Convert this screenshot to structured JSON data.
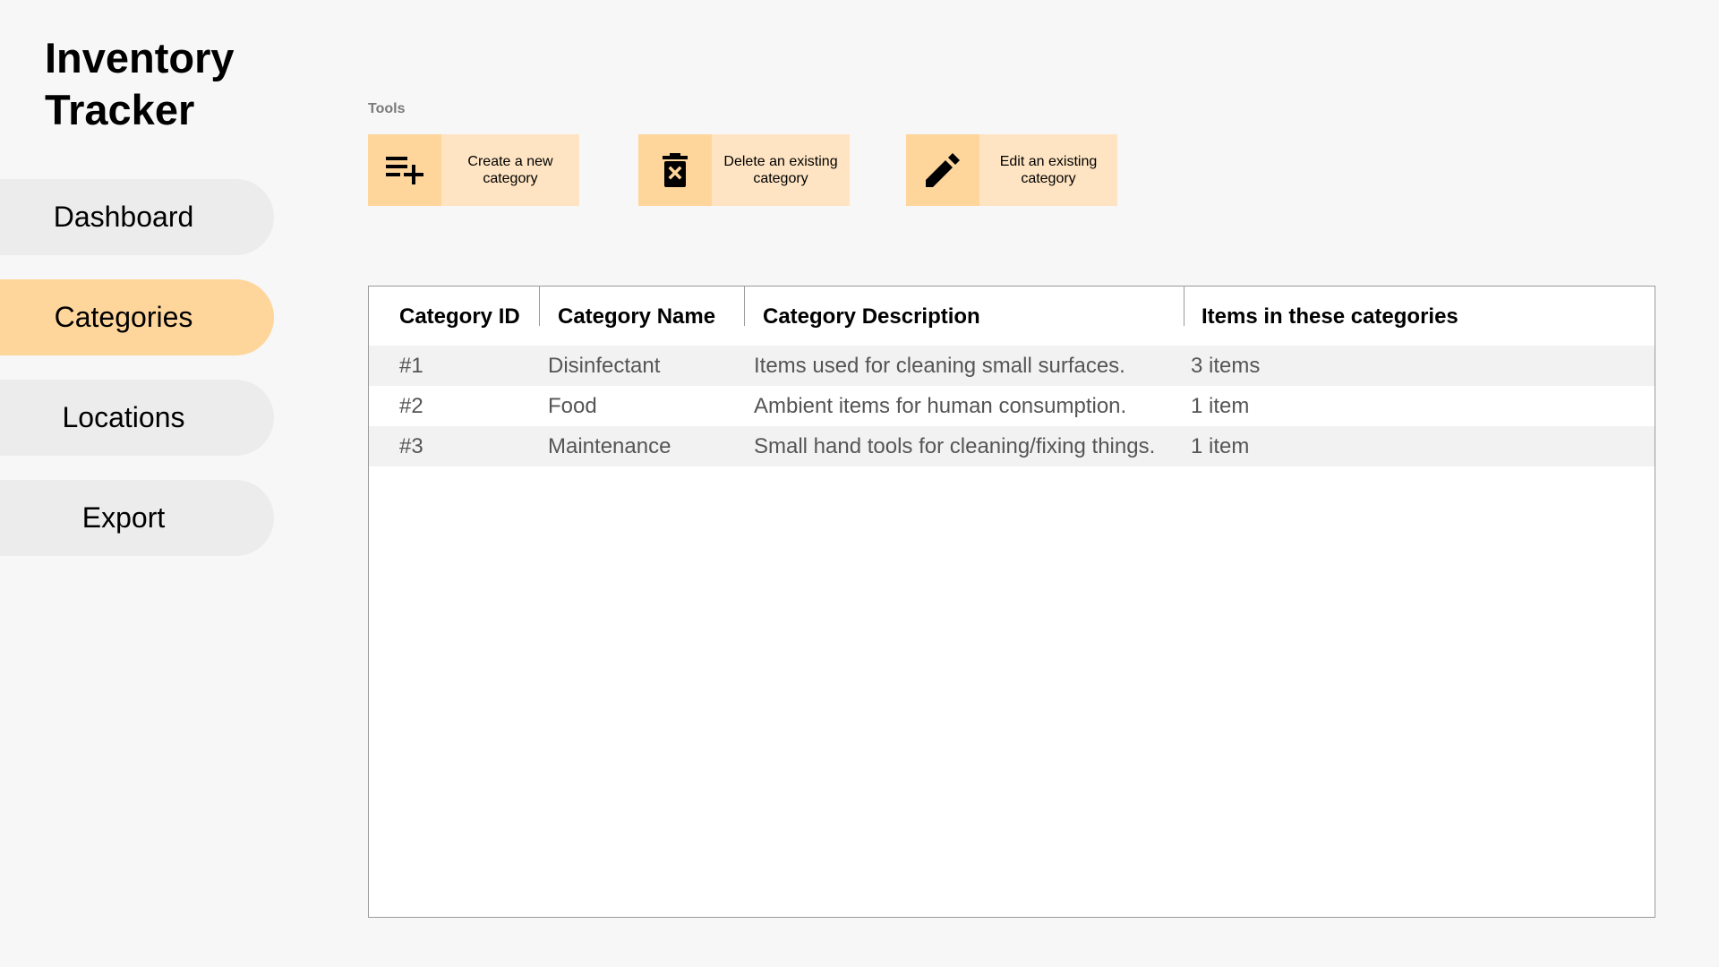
{
  "app": {
    "title_line1": "Inventory",
    "title_line2": "Tracker"
  },
  "sidebar": {
    "items": [
      {
        "label": "Dashboard",
        "active": false
      },
      {
        "label": "Categories",
        "active": true
      },
      {
        "label": "Locations",
        "active": false
      },
      {
        "label": "Export",
        "active": false
      }
    ]
  },
  "tools": {
    "label": "Tools",
    "buttons": [
      {
        "label": "Create a new category",
        "icon": "playlist-add-icon"
      },
      {
        "label": "Delete an existing category",
        "icon": "trash-icon"
      },
      {
        "label": "Edit an existing category",
        "icon": "pencil-icon"
      }
    ]
  },
  "table": {
    "headers": [
      "Category ID",
      "Category Name",
      "Category Description",
      "Items in these categories"
    ],
    "rows": [
      [
        "#1",
        "Disinfectant",
        "Items used for cleaning small surfaces.",
        "3 items"
      ],
      [
        "#2",
        "Food",
        "Ambient items for human consumption.",
        "1 item"
      ],
      [
        "#3",
        "Maintenance",
        "Small hand tools for cleaning/fixing things.",
        "1 item"
      ]
    ]
  },
  "colors": {
    "accent": "#fed69c",
    "accent_light": "#fee4c2",
    "nav_bg": "#ececec",
    "page_bg": "#f7f7f7",
    "row_alt": "#f2f2f2"
  }
}
